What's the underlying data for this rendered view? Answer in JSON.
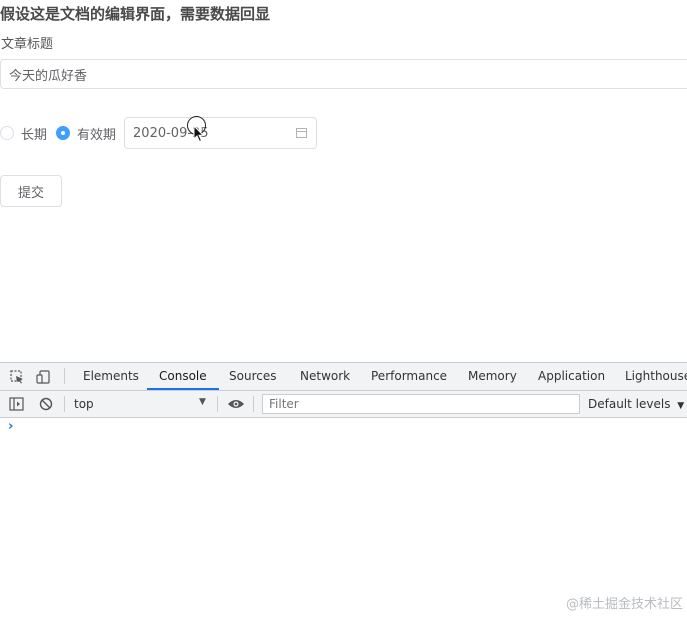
{
  "page": {
    "heading": "假设这是文档的编辑界面，需要数据回显",
    "title_label": "文章标题",
    "title_value": "今天的瓜好香",
    "radio_options": [
      {
        "label": "长期",
        "checked": false
      },
      {
        "label": "有效期",
        "checked": true
      }
    ],
    "date_value": "2020-09-25",
    "submit_label": "提交"
  },
  "devtools": {
    "tabs": [
      "Elements",
      "Console",
      "Sources",
      "Network",
      "Performance",
      "Memory",
      "Application",
      "Lighthouse"
    ],
    "active_tab": "Console",
    "context": "top",
    "filter_placeholder": "Filter",
    "levels_label": "Default levels",
    "prompt_symbol": "›"
  },
  "watermark": "@稀土掘金技术社区",
  "colors": {
    "accent": "#409eff",
    "devtools_accent": "#1a73e8",
    "border": "#dcdfe6"
  },
  "icons": [
    "inspect-element-icon",
    "device-toggle-icon",
    "sidebar-toggle-icon",
    "clear-console-icon",
    "eye-icon",
    "calendar-icon",
    "mouse-pointer-icon"
  ]
}
